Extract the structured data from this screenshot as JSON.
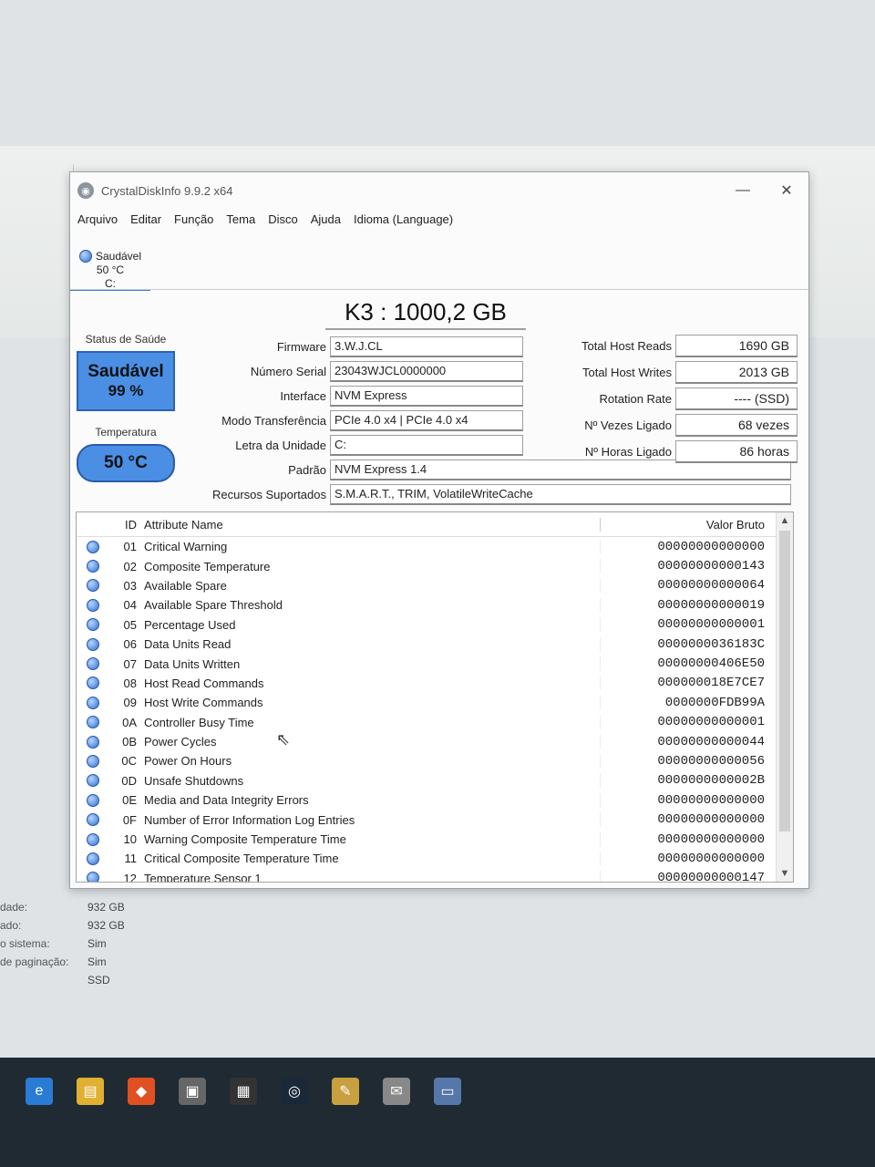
{
  "window": {
    "title": "CrystalDiskInfo 9.9.2 x64",
    "minimize": "—",
    "close": "✕"
  },
  "menu": [
    "Arquivo",
    "Editar",
    "Função",
    "Tema",
    "Disco",
    "Ajuda",
    "Idioma (Language)"
  ],
  "drive_tab": {
    "status": "Saudável",
    "temp": "50 °C",
    "letter": "C:"
  },
  "drive_title": "K3 : 1000,2 GB",
  "health": {
    "label": "Status de Saúde",
    "status": "Saudável",
    "percent": "99 %"
  },
  "temperature": {
    "label": "Temperatura",
    "value": "50 °C"
  },
  "fields": [
    {
      "label": "Firmware",
      "value": "3.W.J.CL"
    },
    {
      "label": "Número Serial",
      "value": "23043WJCL0000000"
    },
    {
      "label": "Interface",
      "value": "NVM Express"
    },
    {
      "label": "Modo Transferência",
      "value": "PCIe 4.0 x4 | PCIe 4.0 x4"
    },
    {
      "label": "Letra da Unidade",
      "value": "C:"
    },
    {
      "label": "Padrão",
      "value": "NVM Express 1.4"
    },
    {
      "label": "Recursos Suportados",
      "value": "S.M.A.R.T., TRIM, VolatileWriteCache"
    }
  ],
  "right_fields": [
    {
      "label": "Total Host Reads",
      "value": "1690 GB"
    },
    {
      "label": "Total Host Writes",
      "value": "2013 GB"
    },
    {
      "label": "Rotation Rate",
      "value": "---- (SSD)"
    },
    {
      "label": "Nº Vezes Ligado",
      "value": "68 vezes"
    },
    {
      "label": "Nº Horas Ligado",
      "value": "86 horas"
    }
  ],
  "table": {
    "headers": {
      "id": "ID",
      "name": "Attribute Name",
      "raw": "Valor Bruto"
    },
    "rows": [
      {
        "id": "01",
        "name": "Critical Warning",
        "raw": "00000000000000"
      },
      {
        "id": "02",
        "name": "Composite Temperature",
        "raw": "00000000000143"
      },
      {
        "id": "03",
        "name": "Available Spare",
        "raw": "00000000000064"
      },
      {
        "id": "04",
        "name": "Available Spare Threshold",
        "raw": "00000000000019"
      },
      {
        "id": "05",
        "name": "Percentage Used",
        "raw": "00000000000001"
      },
      {
        "id": "06",
        "name": "Data Units Read",
        "raw": "0000000036183C"
      },
      {
        "id": "07",
        "name": "Data Units Written",
        "raw": "00000000406E50"
      },
      {
        "id": "08",
        "name": "Host Read Commands",
        "raw": "000000018E7CE7"
      },
      {
        "id": "09",
        "name": "Host Write Commands",
        "raw": "0000000FDB99A"
      },
      {
        "id": "0A",
        "name": "Controller Busy Time",
        "raw": "00000000000001"
      },
      {
        "id": "0B",
        "name": "Power Cycles",
        "raw": "00000000000044"
      },
      {
        "id": "0C",
        "name": "Power On Hours",
        "raw": "00000000000056"
      },
      {
        "id": "0D",
        "name": "Unsafe Shutdowns",
        "raw": "0000000000002B"
      },
      {
        "id": "0E",
        "name": "Media and Data Integrity Errors",
        "raw": "00000000000000"
      },
      {
        "id": "0F",
        "name": "Number of Error Information Log Entries",
        "raw": "00000000000000"
      },
      {
        "id": "10",
        "name": "Warning Composite Temperature Time",
        "raw": "00000000000000"
      },
      {
        "id": "11",
        "name": "Critical Composite Temperature Time",
        "raw": "00000000000000"
      },
      {
        "id": "12",
        "name": "Temperature Sensor 1",
        "raw": "00000000000147"
      }
    ]
  },
  "background_info": [
    {
      "label": "dade:",
      "value": "932 GB"
    },
    {
      "label": "ado:",
      "value": "932 GB"
    },
    {
      "label": "o sistema:",
      "value": "Sim"
    },
    {
      "label": "de paginação:",
      "value": "Sim"
    },
    {
      "label": "",
      "value": "SSD"
    }
  ],
  "colors": {
    "health_blue": "#4a8fe4",
    "accent": "#3b7ad9",
    "taskbar": "#1f2a33"
  },
  "taskbar_icons": [
    "edge-icon",
    "explorer-icon",
    "brave-icon",
    "folder-icon",
    "epic-icon",
    "steam-icon",
    "app-icon",
    "mail-icon",
    "network-icon"
  ]
}
